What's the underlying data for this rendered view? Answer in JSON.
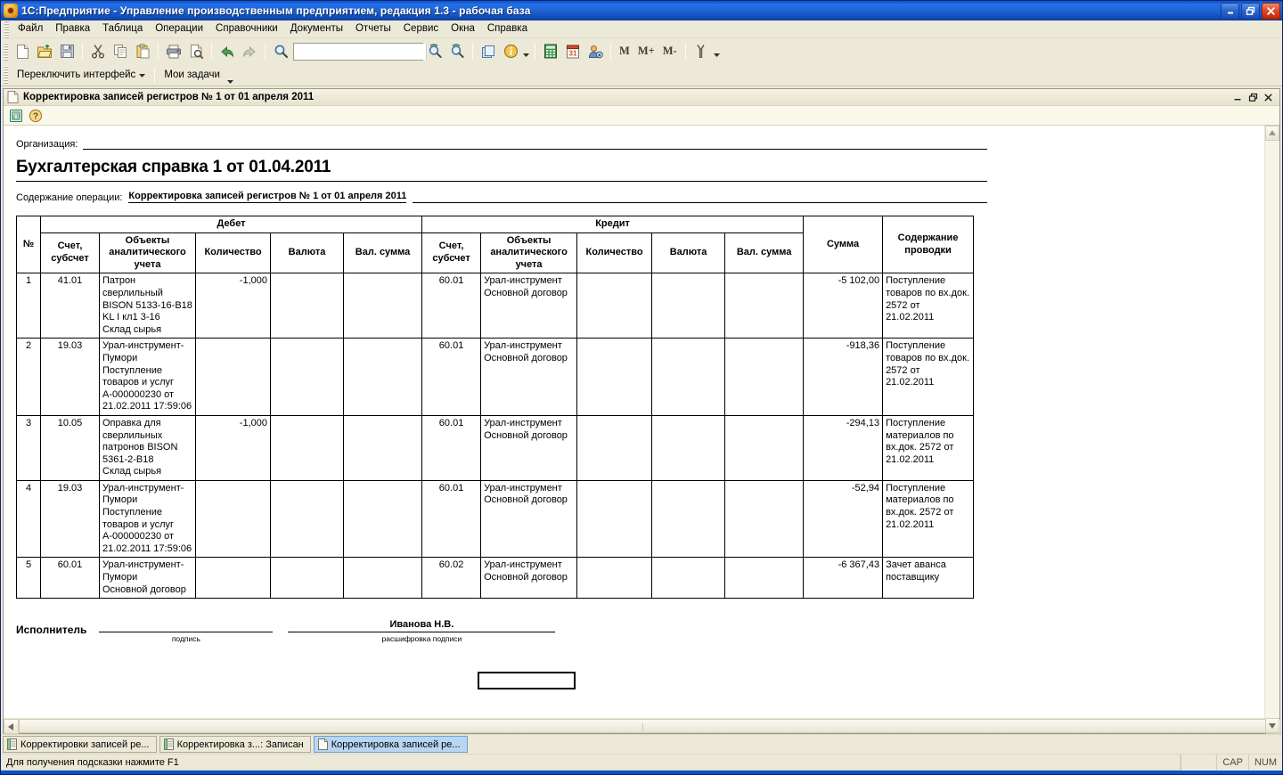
{
  "window": {
    "title": "1С:Предприятие - Управление производственным предприятием, редакция 1.3 - рабочая база",
    "minimize_label": "–",
    "restore_label": "❐",
    "close_label": "✕"
  },
  "menubar": {
    "items": [
      {
        "label": "Файл",
        "accel": "Ф"
      },
      {
        "label": "Правка",
        "accel": "П"
      },
      {
        "label": "Таблица",
        "accel": ""
      },
      {
        "label": "Операции",
        "accel": ""
      },
      {
        "label": "Справочники",
        "accel": ""
      },
      {
        "label": "Документы",
        "accel": ""
      },
      {
        "label": "Отчеты",
        "accel": ""
      },
      {
        "label": "Сервис",
        "accel": "С"
      },
      {
        "label": "Окна",
        "accel": "О"
      },
      {
        "label": "Справка",
        "accel": ""
      }
    ]
  },
  "toolbar": {
    "icons": [
      "new-document-icon",
      "open-folder-icon",
      "save-icon",
      "cut-icon",
      "copy-icon",
      "paste-icon",
      "print-icon",
      "print-preview-icon",
      "back-arrow-icon",
      "forward-arrow-icon",
      "search-icon"
    ],
    "search_value": "",
    "search_placeholder": "",
    "icons_right": [
      "find-next-icon",
      "find-prev-icon",
      "copy-window-icon",
      "info-icon",
      "calculator-icon",
      "calendar-icon",
      "user-settings-icon"
    ],
    "memory_buttons": [
      "M",
      "M+",
      "M-"
    ],
    "tools_icon": "wrench-icon"
  },
  "toolbar2": {
    "switch_interface": "Переключить интерфейс",
    "my_tasks": "Мои задачи"
  },
  "child_window": {
    "title": "Корректировка записей регистров № 1 от 01 апреля 2011",
    "icon": "document-icon",
    "minimize_label": "_",
    "restore_label": "❐",
    "close_label": "✕",
    "toolbar_icons": [
      "save-to-file-icon",
      "help-icon"
    ]
  },
  "report": {
    "org_label": "Организация:",
    "org_value": "",
    "title": "Бухгалтерская справка 1 от 01.04.2011",
    "operation_label": "Содержание операции:",
    "operation_value": "Корректировка записей регистров № 1 от 01 апреля 2011",
    "table": {
      "headers": {
        "num": "№",
        "debit_group": "Дебет",
        "credit_group": "Кредит",
        "account": "Счет,\nсубсчет",
        "objects": "Объекты\nаналитического\nучета",
        "quantity": "Количество",
        "currency": "Валюта",
        "currency_amount": "Вал. сумма",
        "sum": "Сумма",
        "description": "Содержание\nпроводки"
      },
      "rows": [
        {
          "num": "1",
          "debit_account": "41.01",
          "debit_objects": "Патрон\nсверлильный\nBISON 5133-16-B18\nKL I кл1 3-16\nСклад сырья",
          "debit_quantity": "-1,000",
          "debit_currency": "",
          "debit_currency_amount": "",
          "credit_account": "60.01",
          "credit_objects": "Урал-инструмент\nОсновной договор",
          "credit_quantity": "",
          "credit_currency": "",
          "credit_currency_amount": "",
          "sum": "-5 102,00",
          "description": "Поступление\nтоваров по вх.док.\n2572 от 21.02.2011"
        },
        {
          "num": "2",
          "debit_account": "19.03",
          "debit_objects": "Урал-инструмент-\nПумори\nПоступление\nтоваров и услуг\nА-000000230 от\n21.02.2011 17:59:06",
          "debit_quantity": "",
          "debit_currency": "",
          "debit_currency_amount": "",
          "credit_account": "60.01",
          "credit_objects": "Урал-инструмент\nОсновной договор",
          "credit_quantity": "",
          "credit_currency": "",
          "credit_currency_amount": "",
          "sum": "-918,36",
          "description": "Поступление\nтоваров по вх.док.\n2572 от 21.02.2011"
        },
        {
          "num": "3",
          "debit_account": "10.05",
          "debit_objects": "Оправка для\nсверлильных\nпатронов BISON\n5361-2-B18\nСклад сырья",
          "debit_quantity": "-1,000",
          "debit_currency": "",
          "debit_currency_amount": "",
          "credit_account": "60.01",
          "credit_objects": "Урал-инструмент\nОсновной договор",
          "credit_quantity": "",
          "credit_currency": "",
          "credit_currency_amount": "",
          "sum": "-294,13",
          "description": "Поступление\nматериалов по\nвх.док. 2572 от\n21.02.2011"
        },
        {
          "num": "4",
          "debit_account": "19.03",
          "debit_objects": "Урал-инструмент-\nПумори\nПоступление\nтоваров и услуг\nА-000000230 от\n21.02.2011 17:59:06",
          "debit_quantity": "",
          "debit_currency": "",
          "debit_currency_amount": "",
          "credit_account": "60.01",
          "credit_objects": "Урал-инструмент\nОсновной договор",
          "credit_quantity": "",
          "credit_currency": "",
          "credit_currency_amount": "",
          "sum": "-52,94",
          "description": "Поступление\nматериалов по\nвх.док. 2572 от\n21.02.2011"
        },
        {
          "num": "5",
          "debit_account": "60.01",
          "debit_objects": "Урал-инструмент-\nПумори\nОсновной договор",
          "debit_quantity": "",
          "debit_currency": "",
          "debit_currency_amount": "",
          "credit_account": "60.02",
          "credit_objects": "Урал-инструмент\nОсновной договор",
          "credit_quantity": "",
          "credit_currency": "",
          "credit_currency_amount": "",
          "sum": "-6 367,43",
          "description": "Зачет аванса\nпоставщику"
        }
      ]
    },
    "signature": {
      "executor_label": "Исполнитель",
      "signature_value": "",
      "signature_caption": "подпись",
      "name_value": "Иванова Н.В.",
      "name_caption": "расшифровка подписи"
    }
  },
  "taskbar": {
    "items": [
      {
        "label": "Корректировки записей ре...",
        "active": false,
        "icon": "document-list-icon"
      },
      {
        "label": "Корректировка з...: Записан",
        "active": false,
        "icon": "document-list-icon"
      },
      {
        "label": "Корректировка записей ре...",
        "active": true,
        "icon": "document-icon"
      }
    ]
  },
  "statusbar": {
    "hint": "Для получения подсказки нажмите F1",
    "cap": "CAP",
    "num": "NUM"
  },
  "colors": {
    "title_bar": "#1e63d4",
    "app_background": "#ece9d8",
    "paper": "#ffffff",
    "active_task": "#b8d6f2"
  }
}
